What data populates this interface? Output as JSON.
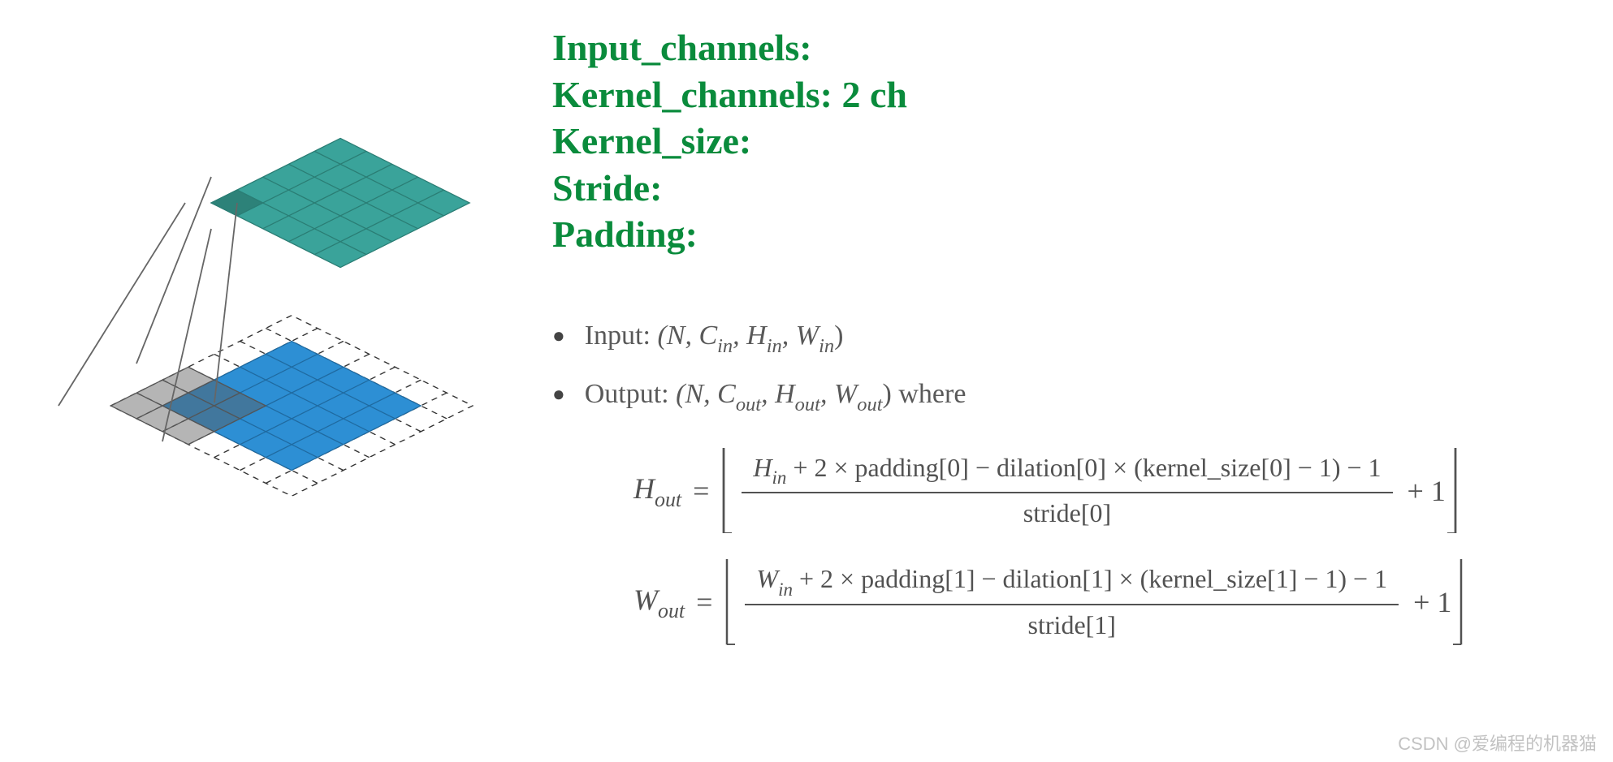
{
  "params": {
    "input_channels": "Input_channels:",
    "kernel_channels": "Kernel_channels: 2 ch",
    "kernel_size": "Kernel_size:",
    "stride": "Stride:",
    "padding": "Padding:"
  },
  "bullets": {
    "input_label": "Input:",
    "input_tuple_pre": "(N, C",
    "input_c_sub": "in",
    "input_h_pre": ", H",
    "input_h_sub": "in",
    "input_w_pre": ", W",
    "input_w_sub": "in",
    "input_close": ")",
    "output_label": "Output:",
    "output_tuple_pre": "(N, C",
    "output_c_sub": "out",
    "output_h_pre": ", H",
    "output_h_sub": "out",
    "output_w_pre": ", W",
    "output_w_sub": "out",
    "output_close": ") where"
  },
  "formulas": {
    "h": {
      "lhs_var": "H",
      "lhs_sub": "out",
      "num_pre": "H",
      "num_sub": "in",
      "num_rest": " + 2 × padding[0] − dilation[0] × (kernel_size[0] − 1) − 1",
      "den": "stride[0]",
      "tail": "+ 1"
    },
    "w": {
      "lhs_var": "W",
      "lhs_sub": "out",
      "num_pre": "W",
      "num_sub": "in",
      "num_rest": " + 2 × padding[1] − dilation[1] × (kernel_size[1] − 1) − 1",
      "den": "stride[1]",
      "tail": "+ 1"
    }
  },
  "watermark": "CSDN @爱编程的机器猫",
  "diagram": {
    "top_grid": {
      "rows": 5,
      "cols": 5,
      "fill": "#3aa39a",
      "stroke": "#2a7d74"
    },
    "bottom_grid": {
      "rows": 5,
      "cols": 5,
      "fill": "#2d8fd4",
      "stroke": "#1f6aa0"
    },
    "padding_cells_per_side": 1,
    "kernel_overlay": {
      "size": 3
    }
  }
}
